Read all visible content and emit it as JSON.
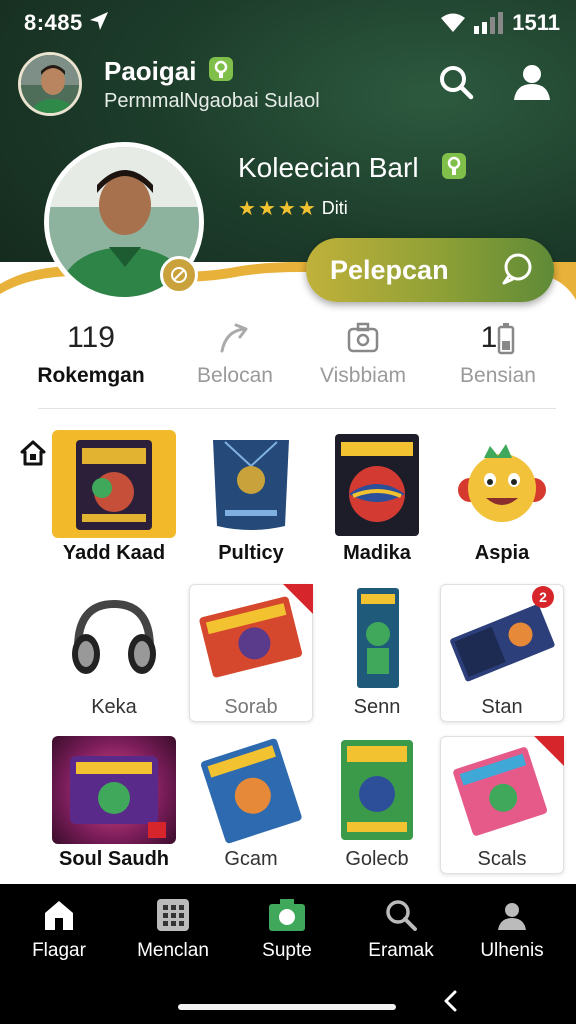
{
  "status": {
    "time": "8:485",
    "clock": "1511"
  },
  "header": {
    "name": "Paoigai",
    "subtitle": "PermmalNgaobai Sulaol"
  },
  "collection": {
    "title": "Koleecian Barl",
    "rating_label": "Diti",
    "stars": 4,
    "cta_label": "Pelepcan"
  },
  "stats": [
    {
      "value": "119",
      "label": "Rokemgan",
      "icon": ""
    },
    {
      "value": "",
      "label": "Belocan",
      "icon": "arrow-icon"
    },
    {
      "value": "",
      "label": "Visbbiam",
      "icon": "camera-icon"
    },
    {
      "value": "1",
      "label": "Bensian",
      "icon": "battery-icon"
    }
  ],
  "items": [
    {
      "label": "Yadd Kaad",
      "art": "card-pack-icon"
    },
    {
      "label": "Pulticy",
      "art": "pouch-icon"
    },
    {
      "label": "Madika",
      "art": "snack-bag-icon"
    },
    {
      "label": "Aspia",
      "art": "emoji-icon"
    },
    {
      "label": "Keka",
      "art": "headphones-icon"
    },
    {
      "label": "Sorab",
      "art": "card-pack-icon"
    },
    {
      "label": "Senn",
      "art": "card-pack-icon"
    },
    {
      "label": "Stan",
      "art": "card-pack-icon",
      "badge": "2"
    },
    {
      "label": "Soul Saudh",
      "art": "card-pack-icon"
    },
    {
      "label": "Gcam",
      "art": "card-pack-icon"
    },
    {
      "label": "Golecb",
      "art": "card-pack-icon"
    },
    {
      "label": "Scals",
      "art": "card-pack-icon"
    }
  ],
  "tabs": [
    {
      "label": "Flagar",
      "icon": "home-icon"
    },
    {
      "label": "Menclan",
      "icon": "grid-icon"
    },
    {
      "label": "Supte",
      "icon": "camera-icon"
    },
    {
      "label": "Eramak",
      "icon": "search-icon"
    },
    {
      "label": "Ulhenis",
      "icon": "profile-icon"
    }
  ],
  "colors": {
    "accent": "#5f8a37",
    "hero": "#1d3d2b",
    "badge": "#d7262b"
  }
}
